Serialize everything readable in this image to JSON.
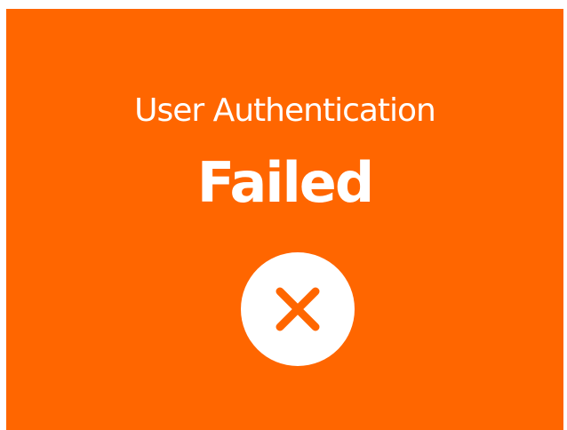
{
  "dialog": {
    "title": "User Authentication",
    "status": "Failed",
    "icon": "close-icon",
    "background_color": "#ff6600",
    "text_color": "#ffffff",
    "icon_circle_color": "#ffffff",
    "icon_stroke_color": "#ff6600"
  }
}
